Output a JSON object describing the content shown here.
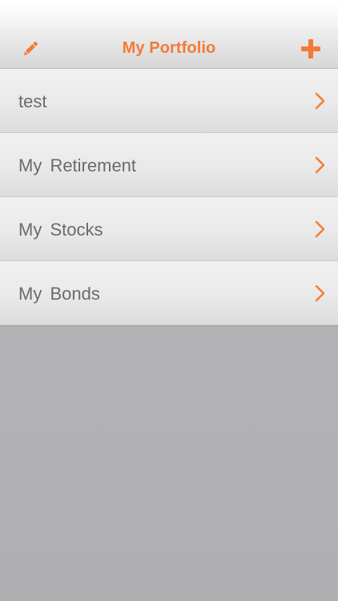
{
  "navbar": {
    "title": "My Portfolio",
    "left_icon": "pencil-icon",
    "right_icon": "plus-icon"
  },
  "portfolios": [
    {
      "label": "test"
    },
    {
      "label": "My Retirement"
    },
    {
      "label": "My Stocks"
    },
    {
      "label": "My Bonds"
    }
  ],
  "colors": {
    "accent": "#f47a35",
    "row_text": "#6b6b6b",
    "empty_background": "#b4b3b6"
  }
}
